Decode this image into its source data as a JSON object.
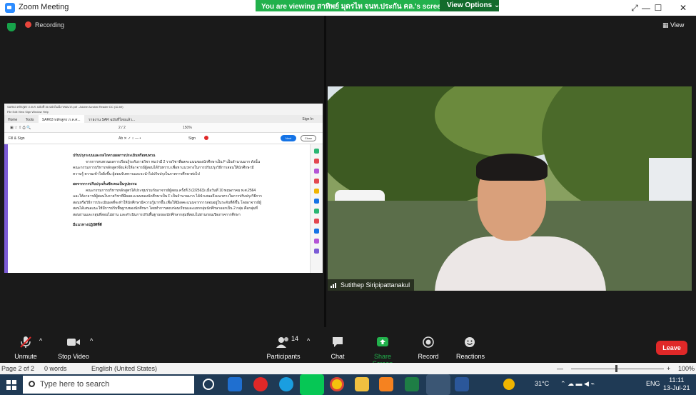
{
  "window": {
    "title": "Zoom Meeting",
    "minimize": "—",
    "maximize": "☐",
    "close": "✕",
    "restore_icon": "⤢"
  },
  "share_banner": {
    "message": "You are viewing สาทิพย์ มุดรไท จนท.ประกัน คล.'s screen",
    "view_options": "View Options ⌄"
  },
  "meeting": {
    "recording_label": "Recording",
    "view_label": "View"
  },
  "shared_screen": {
    "acrobat_title": "SAR63 หลักสูตร ภ.ค.ศ. ฉบับที่ 36 ฉบับไม่มีภาคผนวก.pdf - Adobe Acrobat Reader DC (32-bit)",
    "menu": "File  Edit  View  Sign  Window  Help",
    "tabs": [
      "Home",
      "Tools",
      "SAR63 หลักสูตร ภ.ค.ศ...",
      "รายงาน SAR ฉบับที่ไทยแล้ว..."
    ],
    "sign_in": "Sign In",
    "page_counter": "2 / 2",
    "zoom_value": "150%",
    "fill_sign_label": "Fill & Sign",
    "sign_label": "Sign",
    "next_label": "Next",
    "close_label": "Close",
    "doc_heading1": "ปรับปรุงระบบและกลไกตามผลการประเมินหรือทบทวน",
    "doc_para1": "จากการทบทวนผลการเรียนรู้ระดับรายวิชา พบว่ามี 2 รายวิชาที่ผลคะแนนของนักศึกษาเป็น F เป็นจำนวนมาก ดังนั้นคณะกรรมการบริหารหลักสูตรจึงแจ้งให้อาจารย์ผู้สอนได้รับทราบ เพื่อหาแนวทางในการปรับปรุงวิธีการสอนให้นักศึกษามีความรู้ ความเข้าใจยิ่งขึ้น ผู้สอนรับทราบและจะนำไปปรับปรุงในภาคการศึกษาต่อไป",
    "doc_heading2": "ผลจากการปรับปรุงเห็นชัดเจนเป็นรูปธรรม",
    "doc_para2": "คณะกรรมการบริหารหลักสูตรได้ประชุมร่วมกับอาจารย์ผู้สอน ครั้งที่ 3 (2/2563) เมื่อวันที่ 10 พฤษภาคม พ.ศ.2564 และให้อาจารย์ผู้สอนในรายวิชาที่มีผลคะแนนของนักศึกษาเป็น F เป็นจำนวนมาก ได้นำเสนอถึงแนวทางในการปรับปรุงวิธีการสอนหรือวิธีการประเมินผลที่จะทำให้นักศึกษามีความรู้มากขึ้น เพื่อให้มีผลคะแนนจากการสอบอยู่ในระดับที่ดีขึ้น โดยอาจารย์ผู้สอนได้เสนอแนะให้มีการปรับพื้นฐานของนักศึกษา โดยทำการสอบก่อนเรียนและแยกกลุ่มนักศึกษาออกเป็น 2 กลุ่ม คือกลุ่มที่สอบผ่านและกลุ่มที่สอบไม่ผ่าน และดำเนินการปรับพื้นฐานของนักศึกษากลุ่มที่สอบไม่ผ่านก่อนเปิดภาคการศึกษา",
    "doc_heading3": "มีแนวทางปฏิบัติที่ดี"
  },
  "participant": {
    "name": "Sutithep Siripipattanakul"
  },
  "controls": {
    "unmute": "Unmute",
    "stop_video": "Stop Video",
    "participants": "Participants",
    "participants_count": "14",
    "chat": "Chat",
    "share_screen": "Share Screen",
    "record": "Record",
    "reactions": "Reactions",
    "leave": "Leave",
    "caret": "^"
  },
  "statusbar": {
    "page": "Page 2 of 2",
    "words": "0 words",
    "language": "English (United States)",
    "minus": "—",
    "plus": "+",
    "zoom": "100%"
  },
  "taskbar": {
    "search_placeholder": "Type here to search",
    "temperature": "31°C",
    "language": "ENG",
    "time": "11:11",
    "date": "13-Jul-21",
    "tray_icons": "⌃ ☁ ▬ ◀ ⌁"
  },
  "colors": {
    "zoom_blue": "#2d8cff",
    "banner_green": "#22b14c",
    "leave_red": "#e02828",
    "share_green": "#22b14c",
    "recording_red": "#e8453c"
  }
}
